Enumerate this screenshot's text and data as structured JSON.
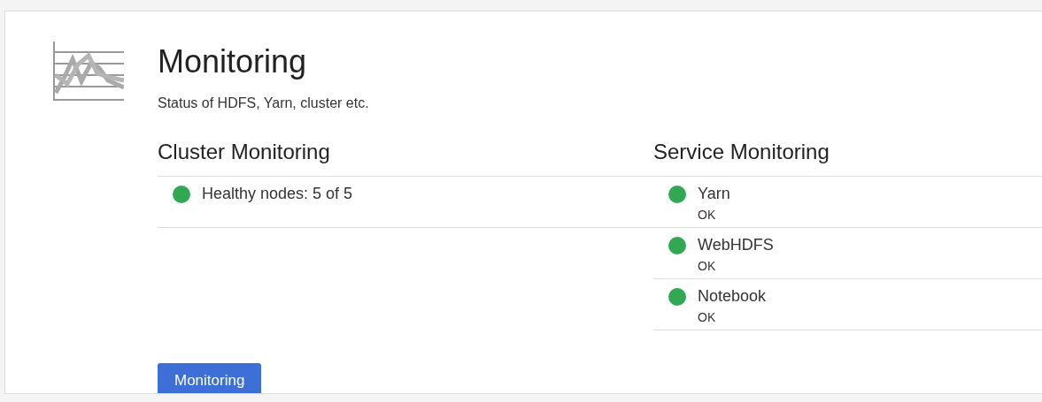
{
  "title": "Monitoring",
  "subtitle": "Status of HDFS, Yarn, cluster etc.",
  "cluster_monitoring": {
    "heading": "Cluster Monitoring",
    "items": [
      {
        "label": "Healthy nodes: 5 of 5",
        "color": "#33a852"
      }
    ]
  },
  "service_monitoring": {
    "heading": "Service Monitoring",
    "items": [
      {
        "name": "Yarn",
        "status": "OK",
        "color": "#33a852"
      },
      {
        "name": "WebHDFS",
        "status": "OK",
        "color": "#33a852"
      },
      {
        "name": "Notebook",
        "status": "OK",
        "color": "#33a852"
      }
    ]
  },
  "button": "Monitoring"
}
